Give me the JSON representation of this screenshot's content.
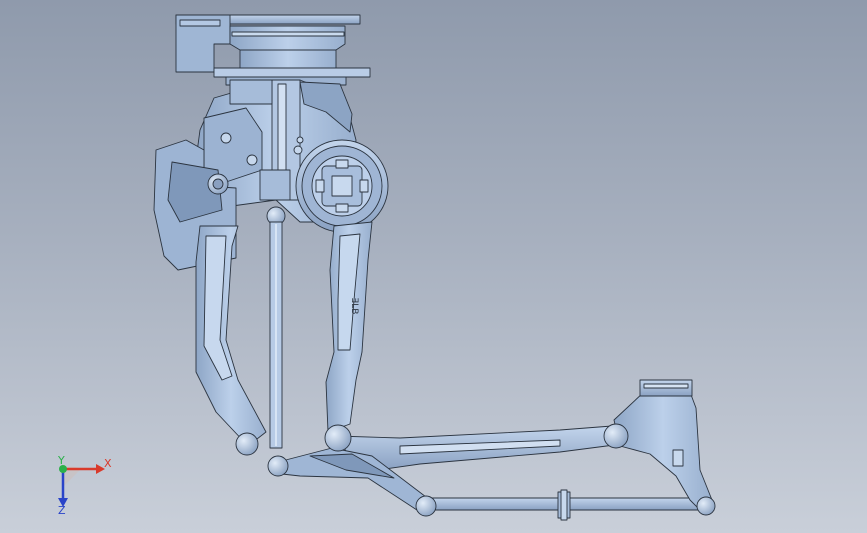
{
  "viewport": {
    "background_top": "#8f9aac",
    "background_bottom": "#c9cfd9",
    "model_color": "#a9bfdc",
    "edge_color": "#2b3440"
  },
  "model": {
    "engraving": "ƎLB"
  },
  "triad": {
    "x_label": "X",
    "y_label": "Y",
    "z_label": "Z",
    "x_color": "#d93a2b",
    "y_color": "#2bb04a",
    "z_color": "#2a44c9"
  }
}
